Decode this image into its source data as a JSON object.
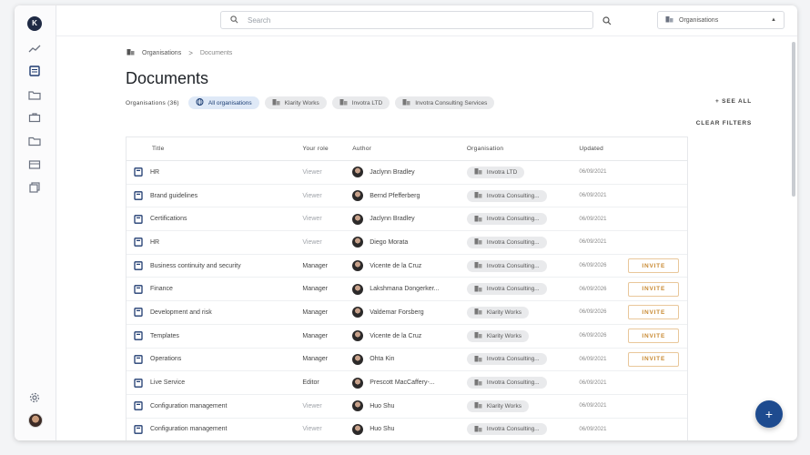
{
  "rail": {
    "logo_letter": "K",
    "icons": [
      "trend-icon",
      "document-icon",
      "folder-icon",
      "briefcase-icon",
      "folder-outline-icon",
      "card-icon",
      "copy-icon"
    ],
    "settings_icon": "gear-icon"
  },
  "search": {
    "placeholder": "Search"
  },
  "org_select": {
    "label": "Organisations"
  },
  "breadcrumb": {
    "root": "Organisations",
    "separator": ">",
    "current": "Documents"
  },
  "page": {
    "title": "Documents"
  },
  "filters": {
    "label": "Organisations (36)",
    "chips": [
      "All organisations",
      "Klarity Works",
      "Invotra LTD",
      "Invotra Consulting Services"
    ],
    "see_all": "+ SEE ALL",
    "clear": "CLEAR FILTERS"
  },
  "table": {
    "headers": {
      "title": "Title",
      "role": "Your role",
      "author": "Author",
      "organisation": "Organisation",
      "updated": "Updated"
    },
    "rows": [
      {
        "title": "HR",
        "role": "Viewer",
        "author": "Jaclynn Bradley",
        "org": "Invotra LTD",
        "updated": "06/09/2021",
        "action": ""
      },
      {
        "title": "Brand guidelines",
        "role": "Viewer",
        "author": "Bernd Pfefferberg",
        "org": "Invotra Consulting...",
        "updated": "06/09/2021",
        "action": ""
      },
      {
        "title": "Certifications",
        "role": "Viewer",
        "author": "Jaclynn Bradley",
        "org": "Invotra Consulting...",
        "updated": "06/09/2021",
        "action": ""
      },
      {
        "title": "HR",
        "role": "Viewer",
        "author": "Diego Morata",
        "org": "Invotra Consulting...",
        "updated": "06/09/2021",
        "action": ""
      },
      {
        "title": "Business continuity and security",
        "role": "Manager",
        "author": "Vicente de la Cruz",
        "org": "Invotra Consulting...",
        "updated": "06/09/2026",
        "action": "INVITE"
      },
      {
        "title": "Finance",
        "role": "Manager",
        "author": "Lakshmana Dongerker...",
        "org": "Invotra Consulting...",
        "updated": "06/09/2026",
        "action": "INVITE"
      },
      {
        "title": "Development and risk",
        "role": "Manager",
        "author": "Valdemar Forsberg",
        "org": "Klarity Works",
        "updated": "06/09/2026",
        "action": "INVITE"
      },
      {
        "title": "Templates",
        "role": "Manager",
        "author": "Vicente de la Cruz",
        "org": "Klarity Works",
        "updated": "06/09/2026",
        "action": "INVITE"
      },
      {
        "title": "Operations",
        "role": "Manager",
        "author": "Ohta Kin",
        "org": "Invotra Consulting...",
        "updated": "06/09/2021",
        "action": "INVITE"
      },
      {
        "title": "Live Service",
        "role": "Editor",
        "author": "Prescott MacCaffery-...",
        "org": "Invotra Consulting...",
        "updated": "06/09/2021",
        "action": ""
      },
      {
        "title": "Configuration management",
        "role": "Viewer",
        "author": "Huo Shu",
        "org": "Klarity Works",
        "updated": "06/09/2021",
        "action": ""
      },
      {
        "title": "Configuration management",
        "role": "Viewer",
        "author": "Huo Shu",
        "org": "Invotra Consulting...",
        "updated": "06/09/2021",
        "action": ""
      }
    ]
  },
  "fab": {
    "label": "+"
  }
}
